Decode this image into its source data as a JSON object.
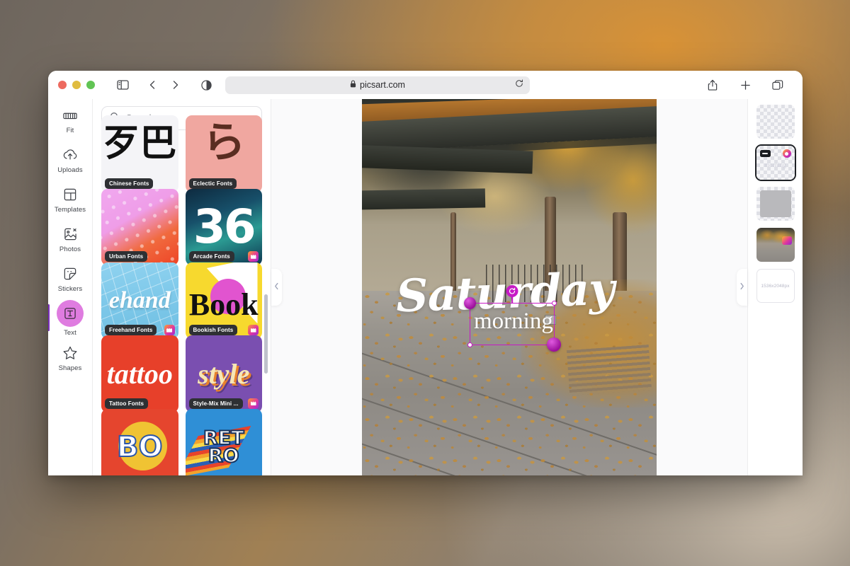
{
  "browser": {
    "url": "picsart.com",
    "lock_icon": "lock-icon",
    "reload_icon": "reload-icon",
    "back_icon": "chevron-left-icon",
    "forward_icon": "chevron-right-icon",
    "sidebar_toggle_icon": "sidebar-toggle-icon",
    "reader_icon": "reader-view-icon",
    "share_icon": "share-icon",
    "new_tab_icon": "plus-icon",
    "tab_overview_icon": "tab-overview-icon",
    "traffic_lights": [
      "close",
      "minimize",
      "zoom"
    ]
  },
  "rail": {
    "items": [
      {
        "label": "Fit",
        "icon": "fit-icon",
        "active": false
      },
      {
        "label": "Uploads",
        "icon": "upload-icon",
        "active": false
      },
      {
        "label": "Templates",
        "icon": "templates-icon",
        "active": false
      },
      {
        "label": "Photos",
        "icon": "photos-icon",
        "active": false
      },
      {
        "label": "Stickers",
        "icon": "sticker-icon",
        "active": false
      },
      {
        "label": "Text",
        "icon": "text-icon",
        "active": true
      },
      {
        "label": "Shapes",
        "icon": "shapes-icon",
        "active": false
      }
    ],
    "active_color": "#df7ce0",
    "active_indicator_color": "#7b2fbe"
  },
  "panel": {
    "search": {
      "placeholder": "Search",
      "value": "",
      "icon": "search-icon"
    },
    "cards": [
      {
        "title": "Chinese Fonts",
        "art": "歹巴",
        "pro": false
      },
      {
        "title": "Eclectic Fonts",
        "art": "ら",
        "pro": false
      },
      {
        "title": "Urban Fonts",
        "art": "",
        "pro": false
      },
      {
        "title": "Arcade Fonts",
        "art": "36",
        "pro": true
      },
      {
        "title": "Freehand Fonts",
        "art": "ehand",
        "pro": true
      },
      {
        "title": "Bookish Fonts",
        "art": "Book",
        "pro": true
      },
      {
        "title": "Tattoo Fonts",
        "art": "tattoo",
        "pro": false
      },
      {
        "title": "Style-Mix Mini ...",
        "art": "style",
        "pro": true
      },
      {
        "title": "",
        "art": "BO",
        "pro": false
      },
      {
        "title": "",
        "art": "RET\nRO",
        "pro": false
      }
    ]
  },
  "canvas": {
    "collapse_left_icon": "chevron-left-icon",
    "collapse_right_icon": "chevron-right-icon",
    "text_layers": [
      {
        "text": "Saturday",
        "style": "script"
      },
      {
        "text": "morning",
        "style": "serif"
      }
    ],
    "selection": {
      "accent_color": "#c61ac6",
      "rotate_icon": "rotate-icon",
      "handles": [
        "top-left",
        "top-right",
        "bottom-left",
        "bottom-right",
        "rotate"
      ]
    }
  },
  "layers": {
    "items": [
      {
        "name": "layer-transparent-top",
        "kind": "checker",
        "selected": false,
        "label": ""
      },
      {
        "name": "layer-text-morning",
        "kind": "text",
        "selected": true,
        "label": "morning"
      },
      {
        "name": "layer-grey-shape",
        "kind": "grey",
        "selected": false,
        "label": ""
      },
      {
        "name": "layer-photo",
        "kind": "photo",
        "selected": false,
        "label": ""
      },
      {
        "name": "layer-canvas-size",
        "kind": "size",
        "selected": false,
        "label": "1536x2048px"
      }
    ]
  }
}
